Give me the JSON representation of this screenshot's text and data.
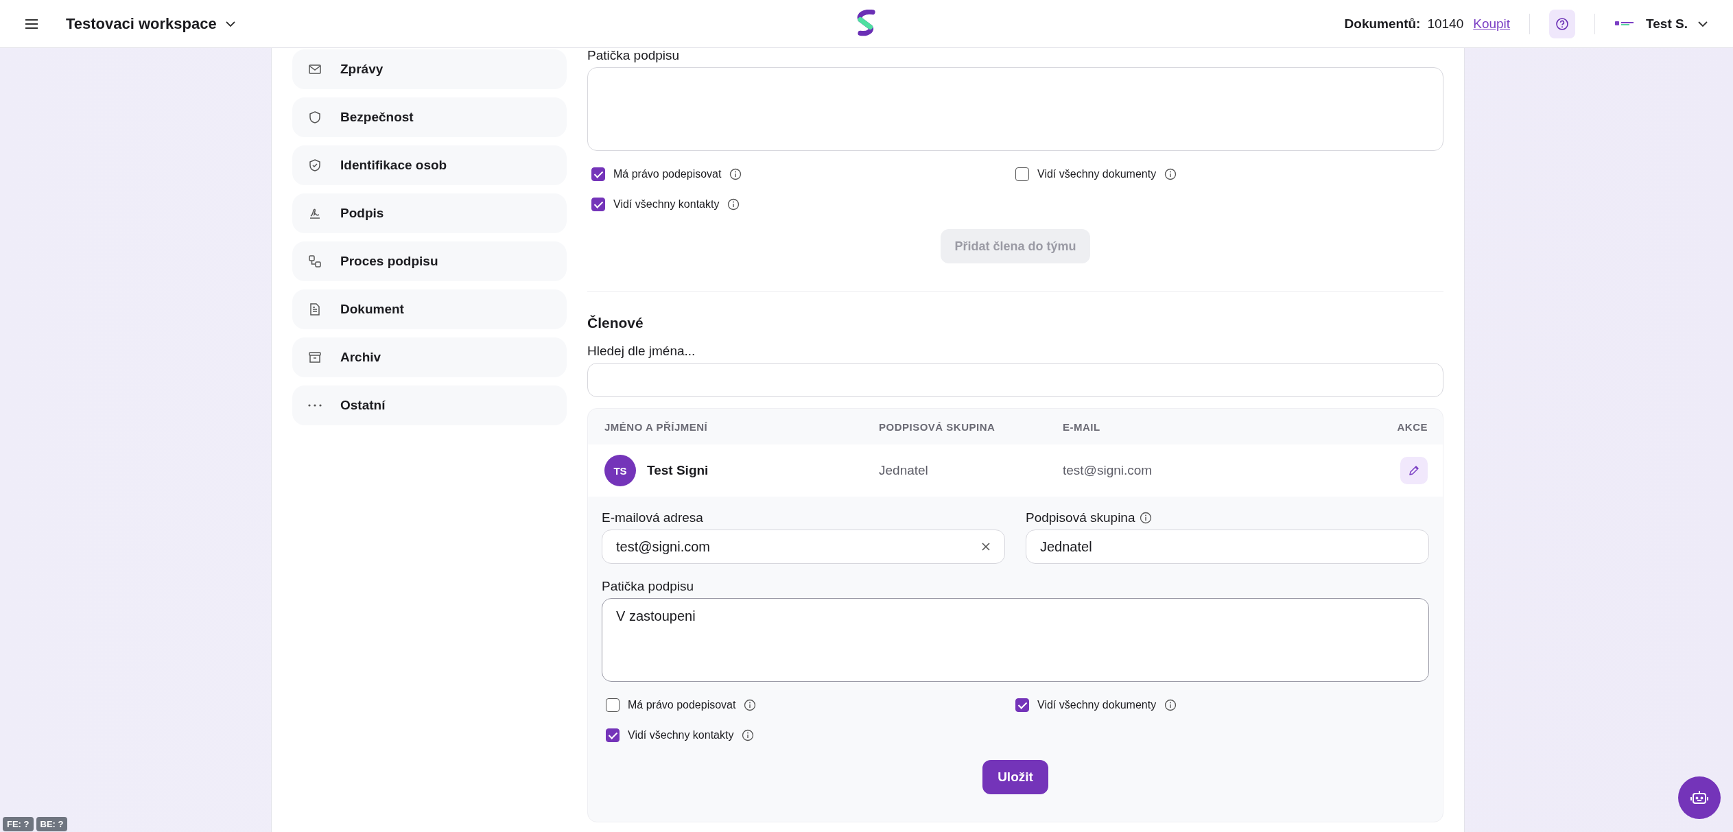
{
  "header": {
    "workspace": "Testovaci workspace",
    "documents_label": "Dokumentů:",
    "documents_count": "10140",
    "buy_link": "Koupit",
    "user_name": "Test S."
  },
  "sidebar": {
    "items": [
      {
        "label": "Zprávy"
      },
      {
        "label": "Bezpečnost"
      },
      {
        "label": "Identifikace osob"
      },
      {
        "label": "Podpis"
      },
      {
        "label": "Proces podpisu"
      },
      {
        "label": "Dokument"
      },
      {
        "label": "Archiv"
      },
      {
        "label": "Ostatní"
      }
    ]
  },
  "new_member": {
    "footer_label": "Patička podpisu",
    "checkboxes": [
      {
        "label": "Má právo podepisovat",
        "checked": true
      },
      {
        "label": "Vidí všechny dokumenty",
        "checked": false
      },
      {
        "label": "Vidí všechny kontakty",
        "checked": true
      }
    ],
    "add_button": {
      "label": "Přidat člena do týmu",
      "disabled": true
    }
  },
  "members": {
    "title": "Členové",
    "search_label": "Hledej dle jména...",
    "table": {
      "columns": [
        "JMÉNO A PŘÍJMENÍ",
        "PODPISOVÁ SKUPINA",
        "E-MAIL",
        "AKCE"
      ],
      "rows": [
        {
          "initials": "TS",
          "name": "Test Signi",
          "group": "Jednatel",
          "email": "test@signi.com"
        }
      ]
    },
    "edit": {
      "email_label": "E-mailová adresa",
      "email_value": "test@signi.com",
      "group_label": "Podpisová skupina",
      "group_value": "Jednatel",
      "footer_label": "Patička podpisu",
      "footer_value": "V zastoupeni",
      "checkboxes": [
        {
          "label": "Má právo podepisovat",
          "checked": false
        },
        {
          "label": "Vidí všechny dokumenty",
          "checked": true
        },
        {
          "label": "Vidí všechny kontakty",
          "checked": true
        }
      ],
      "save_button": "Uložit"
    }
  },
  "debug_badges": [
    "FE: ?",
    "BE: ?"
  ]
}
